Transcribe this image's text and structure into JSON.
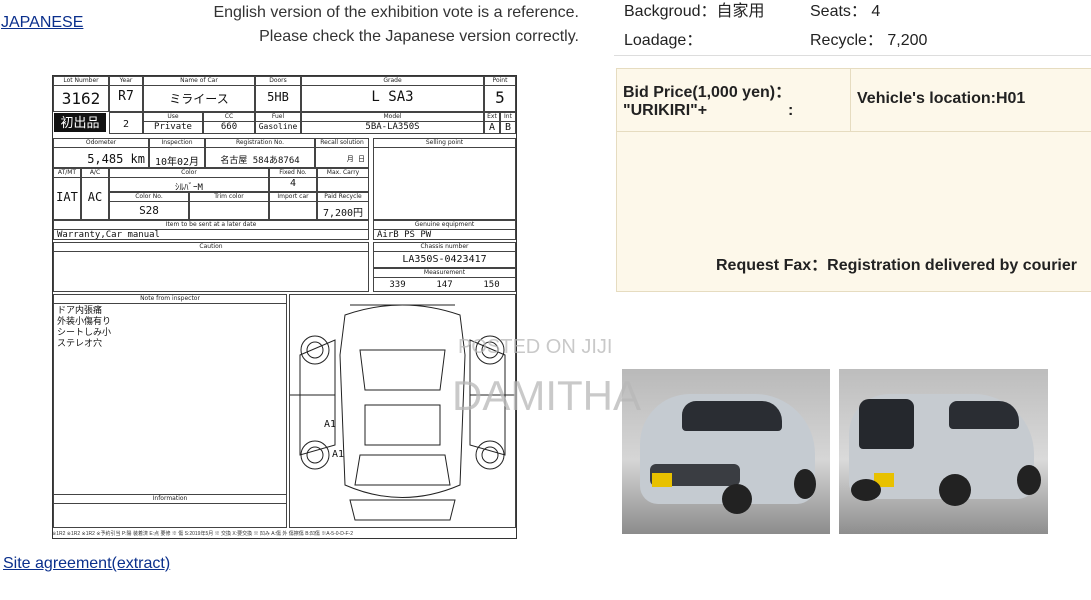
{
  "header": {
    "japanese_link": "JAPANESE",
    "note_line1": "English version of the exhibition vote is a reference.",
    "note_line2": "Please check the Japanese version correctly."
  },
  "specs": {
    "background_label": "Backgroud：自家用",
    "seats_label": "Seats： 4",
    "loadage_label": "Loadage：",
    "recycle_label": "Recycle： 7,200"
  },
  "bid": {
    "price_label": "Bid Price(1,000 yen)：",
    "urikiri_label": "\"URIKIRI\"+",
    "colon": ":",
    "location_label": "Vehicle's location:H01",
    "request_fax": "Request Fax：Registration delivered by courier"
  },
  "sheet": {
    "lot_hd": "Lot Number",
    "lot": "3162",
    "year_hd": "Year",
    "year": "R7",
    "year2": "2",
    "name_hd": "Name of Car",
    "name": "ミライース",
    "doors_hd": "Doors",
    "doors": "5HB",
    "grade_hd": "Grade",
    "grade": "L SA3",
    "point_hd": "Point",
    "point": "5",
    "badge": "初出品",
    "use_hd": "Use",
    "use": "Private",
    "cc_hd": "CC",
    "cc": "660",
    "fuel_hd": "Fuel",
    "fuel": "Gasoline",
    "model_hd": "Model",
    "model": "5BA-LA350S",
    "ext_hd": "Ext",
    "ext": "A",
    "int_hd": "Int",
    "int": "B",
    "odo_hd": "Odometer",
    "odo": "5,485 km",
    "insp_hd": "Inspection",
    "insp": "10年02月",
    "reg_hd": "Registration No.",
    "reg": "名古屋 584あ8764",
    "recall_hd": "Recall solution",
    "recall": "月 日",
    "sell_hd": "Selling point",
    "trans_hd": "AT/MT",
    "trans": "IAT",
    "ac_hd": "A/C",
    "ac": "AC",
    "color_hd": "Color",
    "color": "ｼﾙﾊﾞｰM",
    "fixed_hd": "Fixed No.",
    "fixed": "4",
    "carry_hd": "Max. Carry",
    "colorno_hd": "Color No.",
    "colorno": "S28",
    "trim_hd": "Trim color",
    "import_hd": "Import car",
    "paidrec_hd": "Paid Recycle",
    "paidrec": "7,200円",
    "item_hd": "Item to be sent at a later date",
    "genuine_hd": "Genuine equipment",
    "warranty": "Warranty,Car manual",
    "equip": "AirB PS PW",
    "caution_hd": "Caution",
    "chassis_hd": "Chassis number",
    "chassis": "LA350S-0423417",
    "meas_hd": "Measurement",
    "len": "339",
    "wid": "147",
    "hei": "150",
    "notes_hd": "Note from inspector",
    "notes": [
      "ドア内張痛",
      "外装小傷有り",
      "シートしみ小",
      "ステレオ穴"
    ],
    "info_hd": "Information",
    "mark1": "A1",
    "mark2": "A1",
    "footer": "※1R2 ※1R2 ※1R2 ※予約引当 P:陽 装着済 E:点 要修 ※ 傷 S:2019年5月 ※ 交換 X:要交換 ※ 凹み A:傷 外 傷擦傷 B:凹傷 ※A-5-0-D-F-2"
  },
  "watermark": {
    "line1": "POSTED ON JIJI",
    "line2": "DAMITHA"
  },
  "footer": {
    "site_agreement": "Site agreement(extract)"
  }
}
